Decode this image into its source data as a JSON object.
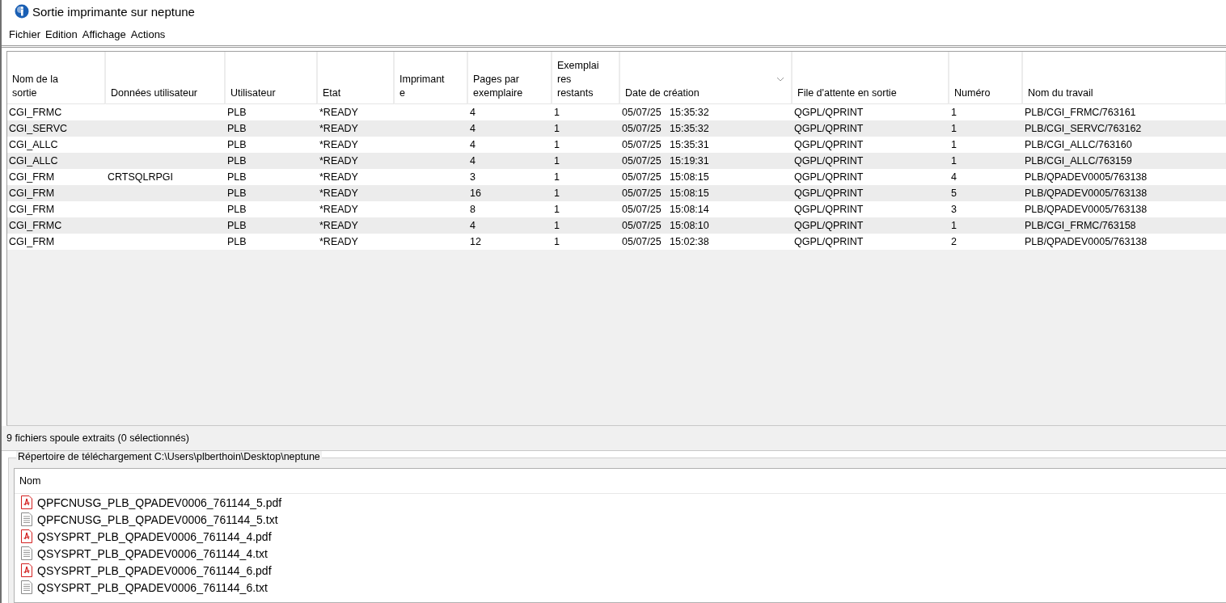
{
  "window": {
    "title": "Sortie imprimante sur neptune"
  },
  "menu": [
    "Fichier",
    "Edition",
    "Affichage",
    "Actions"
  ],
  "table": {
    "columns": [
      {
        "label": "Nom de la sortie",
        "sorted": false
      },
      {
        "label": "Données utilisateur",
        "sorted": false
      },
      {
        "label": "Utilisateur",
        "sorted": false
      },
      {
        "label": "Etat",
        "sorted": false
      },
      {
        "label": "Imprimant e",
        "sorted": false
      },
      {
        "label": "Pages par exemplaire",
        "sorted": false
      },
      {
        "label": "Exemplai res restants",
        "sorted": false
      },
      {
        "label": "Date de création",
        "sorted": true
      },
      {
        "label": "File d'attente en sortie",
        "sorted": false
      },
      {
        "label": "Numéro",
        "sorted": false
      },
      {
        "label": "Nom du travail",
        "sorted": false
      }
    ],
    "rows": [
      [
        "CGI_FRMC",
        "",
        "PLB",
        "*READY",
        "",
        "4",
        "1",
        "05/07/25   15:35:32",
        "QGPL/QPRINT",
        "1",
        "PLB/CGI_FRMC/763161"
      ],
      [
        "CGI_SERVC",
        "",
        "PLB",
        "*READY",
        "",
        "4",
        "1",
        "05/07/25   15:35:32",
        "QGPL/QPRINT",
        "1",
        "PLB/CGI_SERVC/763162"
      ],
      [
        "CGI_ALLC",
        "",
        "PLB",
        "*READY",
        "",
        "4",
        "1",
        "05/07/25   15:35:31",
        "QGPL/QPRINT",
        "1",
        "PLB/CGI_ALLC/763160"
      ],
      [
        "CGI_ALLC",
        "",
        "PLB",
        "*READY",
        "",
        "4",
        "1",
        "05/07/25   15:19:31",
        "QGPL/QPRINT",
        "1",
        "PLB/CGI_ALLC/763159"
      ],
      [
        "CGI_FRM",
        "CRTSQLRPGI",
        "PLB",
        "*READY",
        "",
        "3",
        "1",
        "05/07/25   15:08:15",
        "QGPL/QPRINT",
        "4",
        "PLB/QPADEV0005/763138"
      ],
      [
        "CGI_FRM",
        "",
        "PLB",
        "*READY",
        "",
        "16",
        "1",
        "05/07/25   15:08:15",
        "QGPL/QPRINT",
        "5",
        "PLB/QPADEV0005/763138"
      ],
      [
        "CGI_FRM",
        "",
        "PLB",
        "*READY",
        "",
        "8",
        "1",
        "05/07/25   15:08:14",
        "QGPL/QPRINT",
        "3",
        "PLB/QPADEV0005/763138"
      ],
      [
        "CGI_FRMC",
        "",
        "PLB",
        "*READY",
        "",
        "4",
        "1",
        "05/07/25   15:08:10",
        "QGPL/QPRINT",
        "1",
        "PLB/CGI_FRMC/763158"
      ],
      [
        "CGI_FRM",
        "",
        "PLB",
        "*READY",
        "",
        "12",
        "1",
        "05/07/25   15:02:38",
        "QGPL/QPRINT",
        "2",
        "PLB/QPADEV0005/763138"
      ]
    ]
  },
  "status_bar": "9 fichiers spoule extraits (0 sélectionnés)",
  "download_group": {
    "title": "Répertoire de téléchargement C:\\Users\\plberthoin\\Desktop\\neptune",
    "column": "Nom",
    "files": [
      {
        "name": "QPFCNUSG_PLB_QPADEV0006_761144_5.pdf",
        "kind": "pdf"
      },
      {
        "name": "QPFCNUSG_PLB_QPADEV0006_761144_5.txt",
        "kind": "txt"
      },
      {
        "name": "QSYSPRT_PLB_QPADEV0006_761144_4.pdf",
        "kind": "pdf"
      },
      {
        "name": "QSYSPRT_PLB_QPADEV0006_761144_4.txt",
        "kind": "txt"
      },
      {
        "name": "QSYSPRT_PLB_QPADEV0006_761144_6.pdf",
        "kind": "pdf"
      },
      {
        "name": "QSYSPRT_PLB_QPADEV0006_761144_6.txt",
        "kind": "txt"
      }
    ]
  }
}
